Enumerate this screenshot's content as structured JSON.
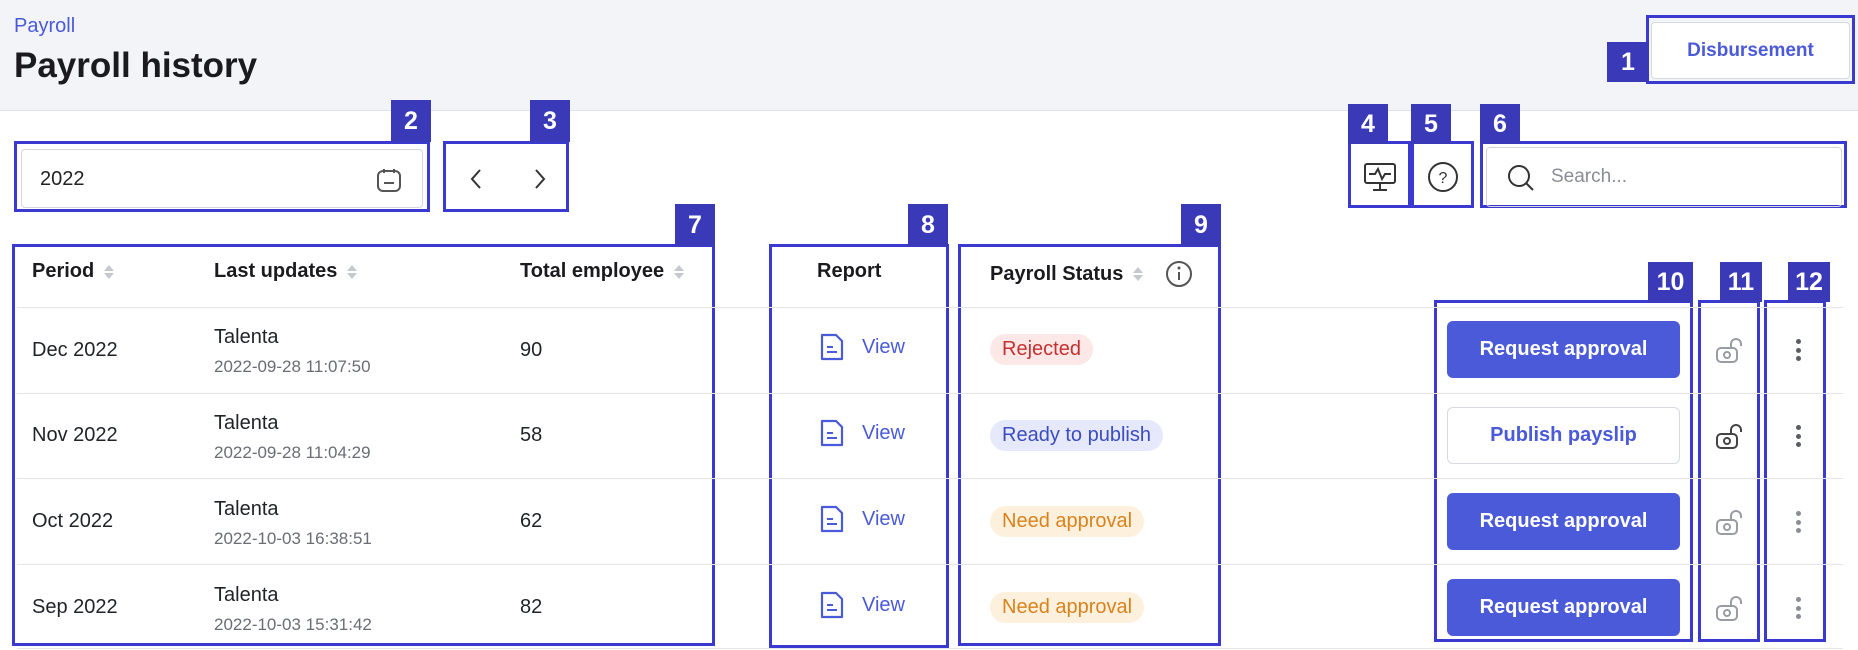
{
  "header": {
    "breadcrumb": "Payroll",
    "title": "Payroll history",
    "disbursement_label": "Disbursement"
  },
  "filters": {
    "year": "2022",
    "search_placeholder": "Search..."
  },
  "table": {
    "columns": {
      "period": "Period",
      "last_updates": "Last updates",
      "total_employee": "Total employee",
      "report": "Report",
      "payroll_status": "Payroll Status"
    },
    "rows": [
      {
        "period": "Dec 2022",
        "updated_by": "Talenta",
        "updated_at": "2022-09-28 11:07:50",
        "total": "90",
        "report": "View",
        "status": "Rejected",
        "status_color": "#c53030",
        "action": "Request approval",
        "action_style": "primary"
      },
      {
        "period": "Nov 2022",
        "updated_by": "Talenta",
        "updated_at": "2022-09-28 11:04:29",
        "total": "58",
        "report": "View",
        "status": "Ready to publish",
        "status_color": "#3b4cc0",
        "action": "Publish payslip",
        "action_style": "outline"
      },
      {
        "period": "Oct 2022",
        "updated_by": "Talenta",
        "updated_at": "2022-10-03 16:38:51",
        "total": "62",
        "report": "View",
        "status": "Need approval",
        "status_color": "#d9821c",
        "action": "Request approval",
        "action_style": "primary"
      },
      {
        "period": "Sep 2022",
        "updated_by": "Talenta",
        "updated_at": "2022-10-03 15:31:42",
        "total": "82",
        "report": "View",
        "status": "Need approval",
        "status_color": "#d9821c",
        "action": "Request approval",
        "action_style": "primary"
      }
    ]
  },
  "annotations": [
    "1",
    "2",
    "3",
    "4",
    "5",
    "6",
    "7",
    "8",
    "9",
    "10",
    "11",
    "12"
  ],
  "colors": {
    "accent": "#4a5ad8",
    "annotation": "#3a3ab8"
  }
}
